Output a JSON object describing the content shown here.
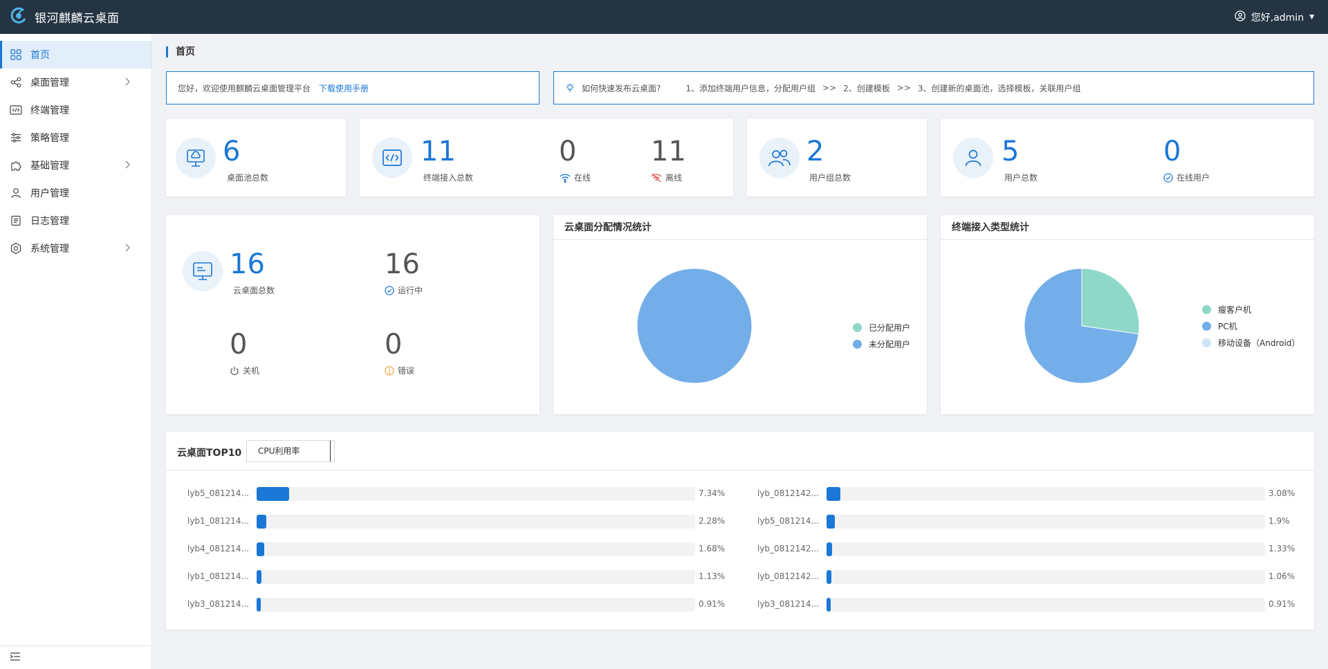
{
  "app": {
    "title": "银河麒麟云桌面",
    "user_greeting": "您好,admin"
  },
  "sidebar": {
    "items": [
      {
        "label": "首页",
        "icon": "grid-icon",
        "active": true,
        "has_submenu": false
      },
      {
        "label": "桌面管理",
        "icon": "network-icon",
        "active": false,
        "has_submenu": true
      },
      {
        "label": "终端管理",
        "icon": "terminal-icon",
        "active": false,
        "has_submenu": false
      },
      {
        "label": "策略管理",
        "icon": "sliders-icon",
        "active": false,
        "has_submenu": false
      },
      {
        "label": "基础管理",
        "icon": "puzzle-icon",
        "active": false,
        "has_submenu": true
      },
      {
        "label": "用户管理",
        "icon": "user-icon",
        "active": false,
        "has_submenu": false
      },
      {
        "label": "日志管理",
        "icon": "document-icon",
        "active": false,
        "has_submenu": false
      },
      {
        "label": "系统管理",
        "icon": "settings-icon",
        "active": false,
        "has_submenu": true
      }
    ]
  },
  "page": {
    "title": "首页"
  },
  "welcome": {
    "text": "您好，欢迎使用麒麟云桌面管理平台",
    "link": "下载使用手册"
  },
  "guide": {
    "question": "如何快速发布云桌面?",
    "step1": "1、添加终端用户信息，分配用户组",
    "sep": ">>",
    "step2": "2、创建模板",
    "step3": "3、创建新的桌面池，选择模板，关联用户组"
  },
  "stats": {
    "pool": {
      "value": "6",
      "label": "桌面池总数"
    },
    "terminal": {
      "value": "11",
      "label": "终端接入总数",
      "online": "0",
      "online_label": "在线",
      "offline": "11",
      "offline_label": "离线"
    },
    "usergroup": {
      "value": "2",
      "label": "用户组总数"
    },
    "users": {
      "value": "5",
      "label": "用户总数",
      "online": "0",
      "online_label": "在线用户"
    },
    "desktops": {
      "total": "16",
      "total_label": "云桌面总数",
      "running": "16",
      "running_label": "运行中",
      "shutdown": "0",
      "shutdown_label": "关机",
      "error": "0",
      "error_label": "错误"
    }
  },
  "colors": {
    "accent": "#1a77d6",
    "assigned": "#8dd8c6",
    "unassigned": "#73aee9",
    "mobile": "#cfe5f7"
  },
  "chart_data": [
    {
      "type": "pie",
      "title": "云桌面分配情况统计",
      "categories": [
        "已分配用户",
        "未分配用户"
      ],
      "values": [
        0,
        16
      ],
      "colors": [
        "#8dd8c6",
        "#73aee9"
      ],
      "legend": "right"
    },
    {
      "type": "pie",
      "title": "终端接入类型统计",
      "categories": [
        "瘦客户机",
        "PC机",
        "移动设备（Android）"
      ],
      "values": [
        3,
        8,
        0
      ],
      "colors": [
        "#8dd8c6",
        "#73aee9",
        "#cfe5f7"
      ],
      "legend": "right"
    },
    {
      "type": "bar",
      "title": "云桌面TOP10",
      "metric": "CPU利用率",
      "columns": [
        [
          {
            "name": "lyb5_081214...",
            "value": 7.34,
            "label": "7.34%"
          },
          {
            "name": "lyb1_081214...",
            "value": 2.28,
            "label": "2.28%"
          },
          {
            "name": "lyb4_081214...",
            "value": 1.68,
            "label": "1.68%"
          },
          {
            "name": "lyb1_081214...",
            "value": 1.13,
            "label": "1.13%"
          },
          {
            "name": "lyb3_081214...",
            "value": 0.91,
            "label": "0.91%"
          }
        ],
        [
          {
            "name": "lyb_0812142...",
            "value": 3.08,
            "label": "3.08%"
          },
          {
            "name": "lyb5_081214...",
            "value": 1.9,
            "label": "1.9%"
          },
          {
            "name": "lyb_0812142...",
            "value": 1.33,
            "label": "1.33%"
          },
          {
            "name": "lyb_0812142...",
            "value": 1.06,
            "label": "1.06%"
          },
          {
            "name": "lyb3_081214...",
            "value": 0.91,
            "label": "0.91%"
          }
        ]
      ],
      "xlim": [
        0,
        100
      ]
    }
  ]
}
